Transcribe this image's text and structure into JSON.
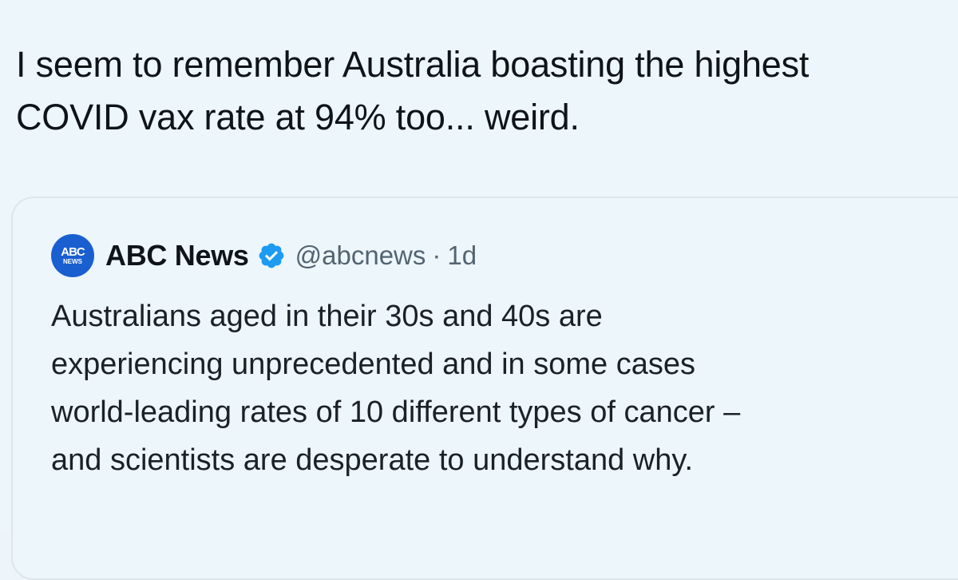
{
  "post": {
    "text": "I seem to remember Australia boasting the highest\nCOVID vax rate at 94% too... weird."
  },
  "quoted_post": {
    "avatar_mark": "ABC",
    "avatar_sub": "NEWS",
    "author_name": "ABC News",
    "handle": "@abcnews",
    "separator": "·",
    "time": "1d",
    "text": "Australians aged in their 30s and 40s are\nexperiencing unprecedented and in some cases\nworld-leading rates of 10 different types of cancer –\nand scientists are desperate to understand why."
  },
  "colors": {
    "background": "#edf6fb",
    "verified_badge": "#1d9bf0",
    "avatar": "#1a5fd0",
    "secondary_text": "#536471"
  },
  "icons": {
    "verified": "verified-badge-icon"
  }
}
